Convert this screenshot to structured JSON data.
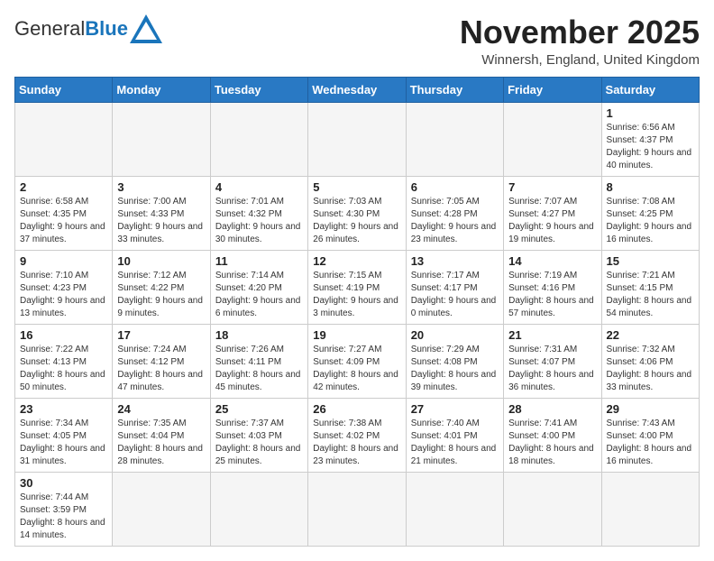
{
  "header": {
    "logo_general": "General",
    "logo_blue": "Blue",
    "month_title": "November 2025",
    "location": "Winnersh, England, United Kingdom"
  },
  "days_of_week": [
    "Sunday",
    "Monday",
    "Tuesday",
    "Wednesday",
    "Thursday",
    "Friday",
    "Saturday"
  ],
  "weeks": [
    [
      {
        "day": "",
        "info": ""
      },
      {
        "day": "",
        "info": ""
      },
      {
        "day": "",
        "info": ""
      },
      {
        "day": "",
        "info": ""
      },
      {
        "day": "",
        "info": ""
      },
      {
        "day": "",
        "info": ""
      },
      {
        "day": "1",
        "info": "Sunrise: 6:56 AM\nSunset: 4:37 PM\nDaylight: 9 hours and 40 minutes."
      }
    ],
    [
      {
        "day": "2",
        "info": "Sunrise: 6:58 AM\nSunset: 4:35 PM\nDaylight: 9 hours and 37 minutes."
      },
      {
        "day": "3",
        "info": "Sunrise: 7:00 AM\nSunset: 4:33 PM\nDaylight: 9 hours and 33 minutes."
      },
      {
        "day": "4",
        "info": "Sunrise: 7:01 AM\nSunset: 4:32 PM\nDaylight: 9 hours and 30 minutes."
      },
      {
        "day": "5",
        "info": "Sunrise: 7:03 AM\nSunset: 4:30 PM\nDaylight: 9 hours and 26 minutes."
      },
      {
        "day": "6",
        "info": "Sunrise: 7:05 AM\nSunset: 4:28 PM\nDaylight: 9 hours and 23 minutes."
      },
      {
        "day": "7",
        "info": "Sunrise: 7:07 AM\nSunset: 4:27 PM\nDaylight: 9 hours and 19 minutes."
      },
      {
        "day": "8",
        "info": "Sunrise: 7:08 AM\nSunset: 4:25 PM\nDaylight: 9 hours and 16 minutes."
      }
    ],
    [
      {
        "day": "9",
        "info": "Sunrise: 7:10 AM\nSunset: 4:23 PM\nDaylight: 9 hours and 13 minutes."
      },
      {
        "day": "10",
        "info": "Sunrise: 7:12 AM\nSunset: 4:22 PM\nDaylight: 9 hours and 9 minutes."
      },
      {
        "day": "11",
        "info": "Sunrise: 7:14 AM\nSunset: 4:20 PM\nDaylight: 9 hours and 6 minutes."
      },
      {
        "day": "12",
        "info": "Sunrise: 7:15 AM\nSunset: 4:19 PM\nDaylight: 9 hours and 3 minutes."
      },
      {
        "day": "13",
        "info": "Sunrise: 7:17 AM\nSunset: 4:17 PM\nDaylight: 9 hours and 0 minutes."
      },
      {
        "day": "14",
        "info": "Sunrise: 7:19 AM\nSunset: 4:16 PM\nDaylight: 8 hours and 57 minutes."
      },
      {
        "day": "15",
        "info": "Sunrise: 7:21 AM\nSunset: 4:15 PM\nDaylight: 8 hours and 54 minutes."
      }
    ],
    [
      {
        "day": "16",
        "info": "Sunrise: 7:22 AM\nSunset: 4:13 PM\nDaylight: 8 hours and 50 minutes."
      },
      {
        "day": "17",
        "info": "Sunrise: 7:24 AM\nSunset: 4:12 PM\nDaylight: 8 hours and 47 minutes."
      },
      {
        "day": "18",
        "info": "Sunrise: 7:26 AM\nSunset: 4:11 PM\nDaylight: 8 hours and 45 minutes."
      },
      {
        "day": "19",
        "info": "Sunrise: 7:27 AM\nSunset: 4:09 PM\nDaylight: 8 hours and 42 minutes."
      },
      {
        "day": "20",
        "info": "Sunrise: 7:29 AM\nSunset: 4:08 PM\nDaylight: 8 hours and 39 minutes."
      },
      {
        "day": "21",
        "info": "Sunrise: 7:31 AM\nSunset: 4:07 PM\nDaylight: 8 hours and 36 minutes."
      },
      {
        "day": "22",
        "info": "Sunrise: 7:32 AM\nSunset: 4:06 PM\nDaylight: 8 hours and 33 minutes."
      }
    ],
    [
      {
        "day": "23",
        "info": "Sunrise: 7:34 AM\nSunset: 4:05 PM\nDaylight: 8 hours and 31 minutes."
      },
      {
        "day": "24",
        "info": "Sunrise: 7:35 AM\nSunset: 4:04 PM\nDaylight: 8 hours and 28 minutes."
      },
      {
        "day": "25",
        "info": "Sunrise: 7:37 AM\nSunset: 4:03 PM\nDaylight: 8 hours and 25 minutes."
      },
      {
        "day": "26",
        "info": "Sunrise: 7:38 AM\nSunset: 4:02 PM\nDaylight: 8 hours and 23 minutes."
      },
      {
        "day": "27",
        "info": "Sunrise: 7:40 AM\nSunset: 4:01 PM\nDaylight: 8 hours and 21 minutes."
      },
      {
        "day": "28",
        "info": "Sunrise: 7:41 AM\nSunset: 4:00 PM\nDaylight: 8 hours and 18 minutes."
      },
      {
        "day": "29",
        "info": "Sunrise: 7:43 AM\nSunset: 4:00 PM\nDaylight: 8 hours and 16 minutes."
      }
    ],
    [
      {
        "day": "30",
        "info": "Sunrise: 7:44 AM\nSunset: 3:59 PM\nDaylight: 8 hours and 14 minutes."
      },
      {
        "day": "",
        "info": ""
      },
      {
        "day": "",
        "info": ""
      },
      {
        "day": "",
        "info": ""
      },
      {
        "day": "",
        "info": ""
      },
      {
        "day": "",
        "info": ""
      },
      {
        "day": "",
        "info": ""
      }
    ]
  ]
}
